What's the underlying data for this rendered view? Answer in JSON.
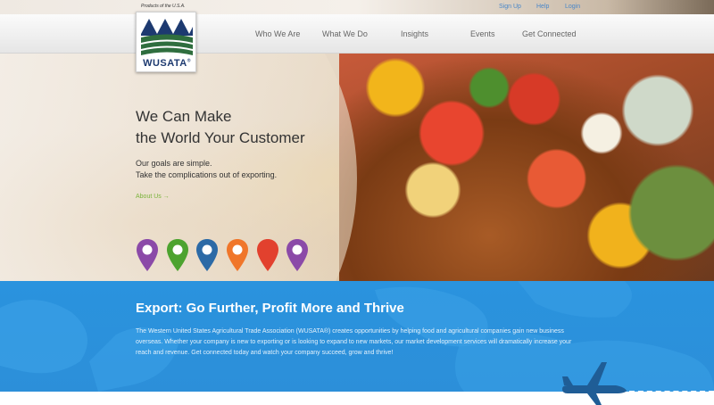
{
  "colors": {
    "brand_navy": "#1d3a70",
    "link_blue": "#4a87c8",
    "link_green": "#79b33b",
    "band_blue": "#2a93de",
    "pin_colors": [
      "#8b4aa8",
      "#4da32f",
      "#2c6aa6",
      "#f0762a",
      "#e2412e",
      "#8b4aa8"
    ]
  },
  "utility_nav": {
    "signup": "Sign Up",
    "help": "Help",
    "login": "Login"
  },
  "logo": {
    "tagline": "Products of the U.S.A.",
    "wordmark": "WUSATA",
    "registered": "®"
  },
  "main_nav": {
    "who_we_are": "Who We Are",
    "what_we_do": "What We Do",
    "insights": "Insights",
    "events": "Events",
    "get_connected": "Get Connected"
  },
  "hero": {
    "title_line1": "We Can Make",
    "title_line2": "the World Your Customer",
    "subtitle_line1": "Our goals are simple.",
    "subtitle_line2": "Take the complications out of exporting.",
    "link": "About Us →"
  },
  "pins": [
    "map-pin-purple",
    "map-pin-green",
    "map-pin-blue",
    "map-pin-orange",
    "map-pin-red",
    "map-pin-purple"
  ],
  "band": {
    "title": "Export: Go Further, Profit More and Thrive",
    "body": "The Western United States Agricultural Trade Association (WUSATA®) creates opportunities by helping food and agricultural companies gain new business overseas. Whether your company is new to exporting or is looking to expand to new markets, our market development services will dramatically increase your reach and revenue. Get connected today and watch your company succeed, grow and thrive!"
  }
}
